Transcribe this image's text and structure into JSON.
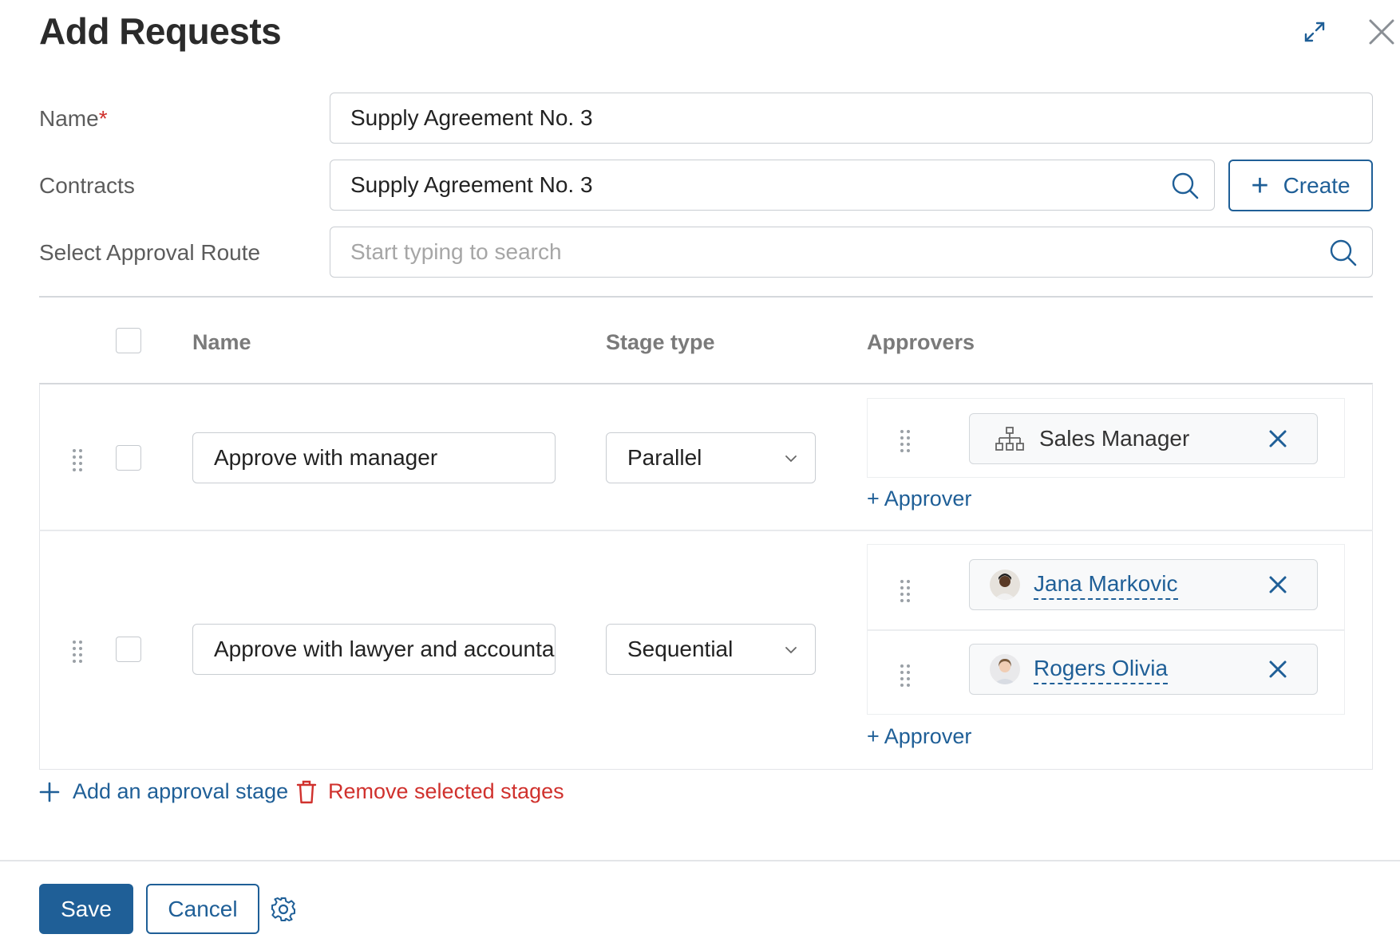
{
  "header": {
    "title": "Add Requests",
    "expand_icon": "expand-icon",
    "close_icon": "close-icon"
  },
  "form": {
    "name": {
      "label": "Name",
      "required_mark": "*",
      "value": "Supply Agreement No. 3"
    },
    "contracts": {
      "label": "Contracts",
      "value": "Supply Agreement No. 3",
      "create_label": "Create"
    },
    "route": {
      "label": "Select Approval Route",
      "placeholder": "Start typing to search"
    }
  },
  "table": {
    "columns": {
      "name": "Name",
      "stage_type": "Stage type",
      "approvers": "Approvers"
    },
    "rows": [
      {
        "name": "Approve with manager",
        "stage_type": "Parallel",
        "approvers": [
          {
            "name": "Sales Manager",
            "kind": "org-structure-icon"
          }
        ],
        "add_label": "+ Approver"
      },
      {
        "name": "Approve with lawyer and accountant",
        "stage_type": "Sequential",
        "approvers": [
          {
            "name": "Jana Markovic",
            "kind": "user-avatar"
          },
          {
            "name": "Rogers Olivia",
            "kind": "user-avatar"
          }
        ],
        "add_label": "+ Approver"
      }
    ]
  },
  "actions": {
    "add_stage": "Add an approval stage",
    "remove_stages": "Remove selected stages"
  },
  "footer": {
    "save": "Save",
    "cancel": "Cancel",
    "settings_icon": "gear-icon"
  },
  "colors": {
    "accent": "#1f5f97",
    "danger": "#d0312d",
    "border": "#c9cdd2",
    "label": "#5c5c5c"
  }
}
